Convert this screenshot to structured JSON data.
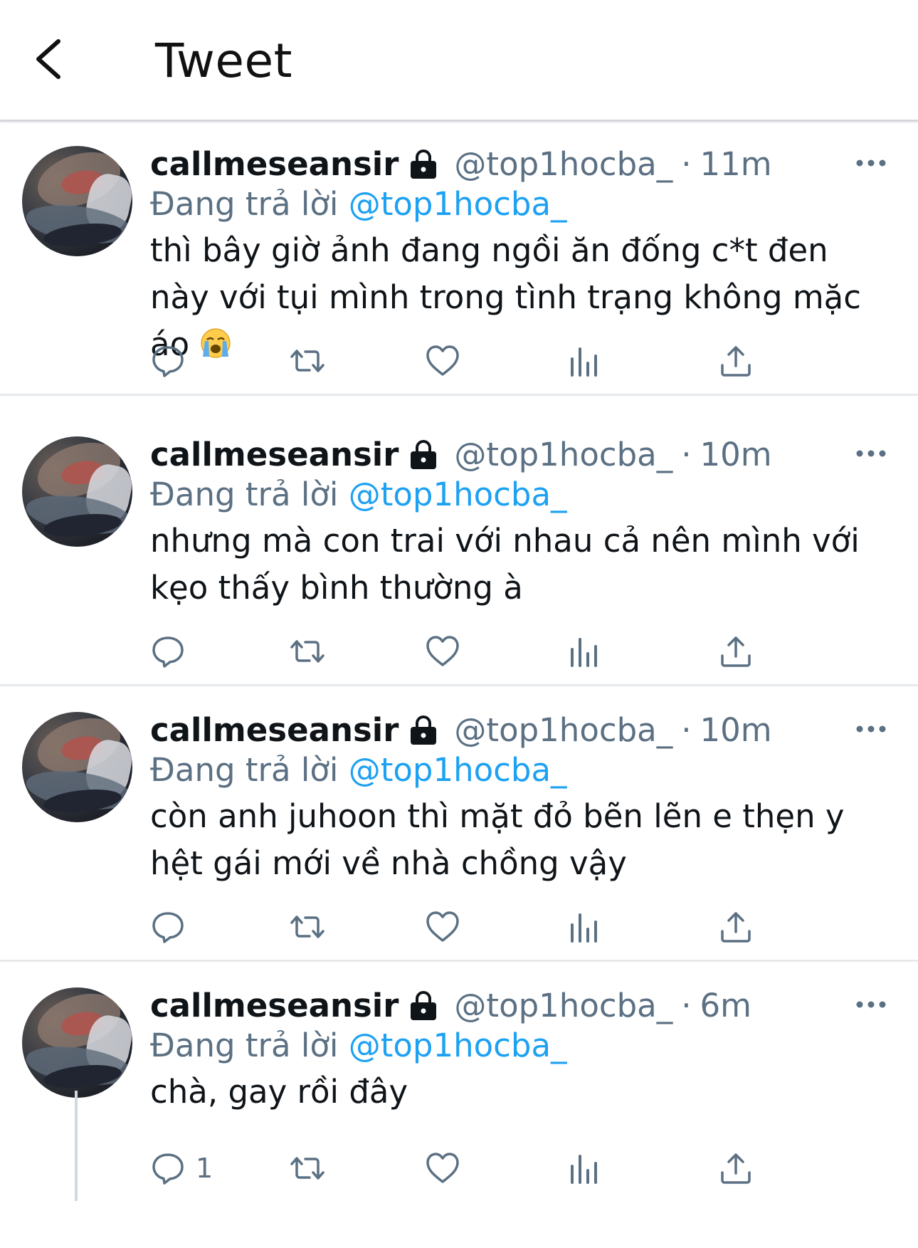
{
  "header": {
    "title": "Tweet",
    "back_icon": "chevron-left-icon"
  },
  "colors": {
    "accent": "#1da1f2",
    "secondary_text": "#5b7083",
    "primary_text": "#0f1419"
  },
  "tweets": [
    {
      "name": "callmeseansir",
      "handle": "@top1hocba_",
      "separator": "·",
      "time": "11m",
      "reply_prefix": "Đang trả lời",
      "reply_to": "@top1hocba_",
      "text": "thì bây giờ ảnh đang ngồi ăn đống c*t đen này với tụi mình trong tình trạng không mặc áo",
      "emoji": "crying-face-emoji",
      "reply_count": ""
    },
    {
      "name": "callmeseansir",
      "handle": "@top1hocba_",
      "separator": "·",
      "time": "10m",
      "reply_prefix": "Đang trả lời",
      "reply_to": "@top1hocba_",
      "text": "nhưng mà con trai với nhau cả nên mình với kẹo thấy bình thường à",
      "reply_count": ""
    },
    {
      "name": "callmeseansir",
      "handle": "@top1hocba_",
      "separator": "·",
      "time": "10m",
      "reply_prefix": "Đang trả lời",
      "reply_to": "@top1hocba_",
      "text": "còn anh juhoon thì mặt đỏ bẽn lẽn e thẹn y hệt gái mới về nhà chồng vậy",
      "reply_count": ""
    },
    {
      "name": "callmeseansir",
      "handle": "@top1hocba_",
      "separator": "·",
      "time": "6m",
      "reply_prefix": "Đang trả lời",
      "reply_to": "@top1hocba_",
      "text": "chà, gay rồi đây",
      "reply_count": "1"
    }
  ]
}
